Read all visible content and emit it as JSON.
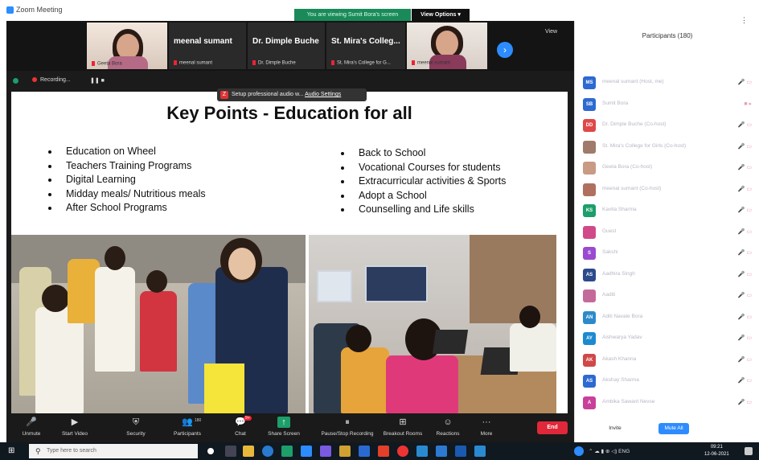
{
  "window": {
    "title": "Zoom Meeting"
  },
  "banner": {
    "viewing": "You are viewing Sumit Bora's screen",
    "view_options": "View Options ▾"
  },
  "strip": {
    "tiles": [
      {
        "label": "Geeta Bora"
      },
      {
        "name": "meenal sumant",
        "sub": "meenal sumant"
      },
      {
        "name": "Dr. Dimple Buche",
        "sub": "Dr. Dimple Buche"
      },
      {
        "name": "St. Mira's Colleg...",
        "sub": "St. Mira's College for G..."
      },
      {
        "label": "meenal sumant"
      }
    ],
    "next": "›",
    "view": "View"
  },
  "recording": {
    "label": "Recording...",
    "controls": "❚❚  ■"
  },
  "tooltip": {
    "icon": "Z",
    "text": "Setup professional audio w...",
    "link": "Audio Settings"
  },
  "slide": {
    "title": "Key Points - Education for all",
    "left_items": [
      "Education on Wheel",
      "Teachers Training Programs",
      "Digital Learning",
      "Midday meals/ Nutritious meals",
      "After School Programs"
    ],
    "right_items": [
      "Back to School",
      "Vocational Courses for students",
      "Extracurricular activities & Sports",
      "Adopt a School",
      "Counselling and Life skills"
    ]
  },
  "toolbar": {
    "items": [
      {
        "icon": "🎤",
        "label": "Unmute"
      },
      {
        "icon": "▶",
        "label": "Start Video"
      },
      {
        "icon": "⛨",
        "label": "Security"
      },
      {
        "icon": "👥",
        "label": "Participants"
      },
      {
        "icon": "💬",
        "label": "Chat"
      },
      {
        "icon": "↑",
        "label": "Share Screen"
      },
      {
        "icon": "⏸",
        "label": "Pause/Stop Recording"
      },
      {
        "icon": "⊞",
        "label": "Breakout Rooms"
      },
      {
        "icon": "☺",
        "label": "Reactions"
      },
      {
        "icon": "···",
        "label": "More"
      }
    ],
    "participants_count": "180",
    "chat_badge": "9+",
    "end": "End"
  },
  "panel": {
    "title": "Participants (180)",
    "menu": "⋮",
    "participants": [
      {
        "initials": "MS",
        "color": "#2d6ad1",
        "name": "meenal sumant (Host, me)",
        "icons": "🎤 ▭"
      },
      {
        "initials": "SB",
        "color": "#2d6ad1",
        "name": "Sumit Bora",
        "icons": "■ ▸"
      },
      {
        "initials": "DD",
        "color": "#e04848",
        "name": "Dr. Dimple Buche (Co-host)",
        "icons": "🎤 ▭"
      },
      {
        "initials": "",
        "color": "#a07a6a",
        "name": "St. Mira's College for Girls (Co-host)",
        "icons": "🎤 ▭"
      },
      {
        "initials": "",
        "color": "#c99a84",
        "name": "Geeta Bora (Co-host)",
        "icons": "🎤 ▭"
      },
      {
        "initials": "",
        "color": "#b07060",
        "name": "meenal sumant (Co-host)",
        "icons": "🎤 ▭"
      },
      {
        "initials": "KS",
        "color": "#1d9e6a",
        "name": "Kavita Sharma",
        "icons": "🎤 ▭"
      },
      {
        "initials": "",
        "color": "#d04a8a",
        "name": "Guest",
        "icons": "🎤 ▭"
      },
      {
        "initials": "S",
        "color": "#9a4ad0",
        "name": "Sakshi",
        "icons": "🎤 ▭"
      },
      {
        "initials": "AS",
        "color": "#2d4a8a",
        "name": "Aadhira Singh",
        "icons": "🎤 ▭"
      },
      {
        "initials": "",
        "color": "#c46a9a",
        "name": "Aaditi",
        "icons": "🎤 ▭"
      },
      {
        "initials": "AN",
        "color": "#2d8ac9",
        "name": "Aditi Navale Bora",
        "icons": "🎤 ▭"
      },
      {
        "initials": "AY",
        "color": "#1d8ad0",
        "name": "Aishwarya Yadav",
        "icons": "🎤 ▭"
      },
      {
        "initials": "AK",
        "color": "#d04848",
        "name": "Akash Khanna",
        "icons": "🎤 ▭"
      },
      {
        "initials": "AS",
        "color": "#2d6ad1",
        "name": "Akshay Sharma",
        "icons": "🎤 ▭"
      },
      {
        "initials": "A",
        "color": "#c9409a",
        "name": "Ambika Sawant Nevse",
        "icons": "🎤 ▭"
      }
    ],
    "invite": "Invite",
    "mute_all": "Mute All"
  },
  "taskbar": {
    "start": "⊞",
    "search_placeholder": "Type here to search",
    "tray": "⌃  ☁  ▮  ⊕  ◁)  ENG",
    "time": "09:21",
    "date": "12-06-2021"
  }
}
